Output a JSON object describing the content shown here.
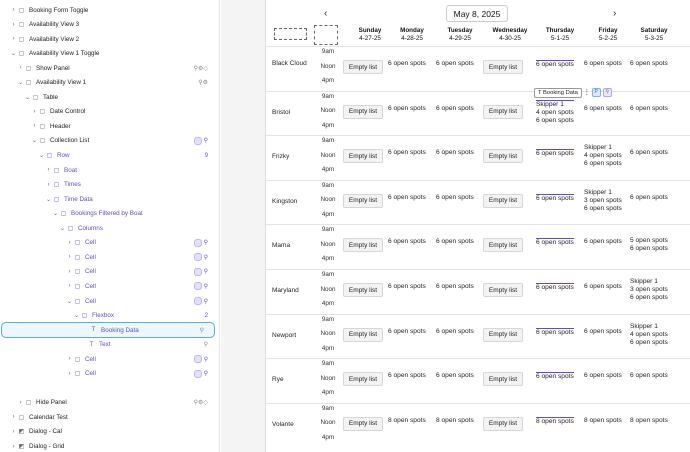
{
  "sidebar": {
    "items": [
      {
        "label": "Booking Form Toggle",
        "indent": 0,
        "chev": "›",
        "ico": "▢",
        "right": ""
      },
      {
        "label": "Availability View 3",
        "indent": 0,
        "chev": "›",
        "ico": "▢",
        "right": ""
      },
      {
        "label": "Availability View 2",
        "indent": 0,
        "chev": "›",
        "ico": "▢",
        "right": ""
      },
      {
        "label": "Availability View 1 Toggle",
        "indent": 0,
        "chev": "⌄",
        "ico": "▢",
        "right": ""
      },
      {
        "label": "Show Panel",
        "indent": 1,
        "chev": "›",
        "ico": "▢",
        "right": "⚲⚙◇"
      },
      {
        "label": "Availability View 1",
        "indent": 1,
        "chev": "⌄",
        "ico": "▢",
        "right": "⚲⚙"
      },
      {
        "label": "Table",
        "indent": 2,
        "chev": "⌄",
        "ico": "▢",
        "right": ""
      },
      {
        "label": "Date Control",
        "indent": 3,
        "chev": "›",
        "ico": "▢",
        "right": ""
      },
      {
        "label": "Header",
        "indent": 3,
        "chev": "›",
        "ico": "▢",
        "right": ""
      },
      {
        "label": "Collection List",
        "indent": 3,
        "chev": "⌄",
        "ico": "▢",
        "right": "pill-link"
      },
      {
        "label": "Row",
        "indent": 4,
        "chev": "⌄",
        "ico": "▢",
        "right": "9",
        "purple": true
      },
      {
        "label": "Boat",
        "indent": 5,
        "chev": "›",
        "ico": "▢",
        "purple": true,
        "right": ""
      },
      {
        "label": "Times",
        "indent": 5,
        "chev": "›",
        "ico": "▢",
        "purple": true,
        "right": ""
      },
      {
        "label": "Time Data",
        "indent": 5,
        "chev": "⌄",
        "ico": "▢",
        "purple": true,
        "right": ""
      },
      {
        "label": "Bookings Filtered by Boat",
        "indent": 6,
        "chev": "⌄",
        "ico": "▢",
        "purple": true,
        "right": ""
      },
      {
        "label": "Columns",
        "indent": 7,
        "chev": "⌄",
        "ico": "▢",
        "purple": true,
        "right": ""
      },
      {
        "label": "Cell",
        "indent": 8,
        "chev": "›",
        "ico": "▢",
        "purple": true,
        "right": "pill-link"
      },
      {
        "label": "Cell",
        "indent": 8,
        "chev": "›",
        "ico": "▢",
        "purple": true,
        "right": "pill-link"
      },
      {
        "label": "Cell",
        "indent": 8,
        "chev": "›",
        "ico": "▢",
        "purple": true,
        "right": "pill-link"
      },
      {
        "label": "Cell",
        "indent": 8,
        "chev": "›",
        "ico": "▢",
        "purple": true,
        "right": "pill-link"
      },
      {
        "label": "Cell",
        "indent": 8,
        "chev": "⌄",
        "ico": "▢",
        "purple": true,
        "right": "pill-link"
      },
      {
        "label": "Flexbox",
        "indent": 9,
        "chev": "⌄",
        "ico": "▢",
        "purple": true,
        "right": "2"
      },
      {
        "label": "Booking Data",
        "indent": 10,
        "chev": "",
        "ico": "T",
        "purple": true,
        "right": "⚲",
        "selected": true
      },
      {
        "label": "Text",
        "indent": 10,
        "chev": "",
        "ico": "T",
        "purple": true,
        "right": "⚲"
      },
      {
        "label": "Cell",
        "indent": 8,
        "chev": "›",
        "ico": "▢",
        "purple": true,
        "right": "pill-link"
      },
      {
        "label": "Cell",
        "indent": 8,
        "chev": "›",
        "ico": "▢",
        "purple": true,
        "right": "pill-link"
      },
      {
        "label": "",
        "indent": 0,
        "chev": "",
        "ico": "",
        "right": ""
      },
      {
        "label": "Hide Panel",
        "indent": 1,
        "chev": "›",
        "ico": "▢",
        "right": "⚲⚙◇"
      },
      {
        "label": "Calendar Test",
        "indent": 0,
        "chev": "›",
        "ico": "▢",
        "right": ""
      },
      {
        "label": "Dialog - Cal",
        "indent": 0,
        "chev": "›",
        "ico": "◩",
        "right": ""
      },
      {
        "label": "Dialog - Grid",
        "indent": 0,
        "chev": "›",
        "ico": "◩",
        "right": ""
      }
    ]
  },
  "calendar": {
    "date": "May 8, 2025",
    "prev": "‹",
    "next": "›",
    "days": [
      {
        "name": "Sunday",
        "date": "4-27-25"
      },
      {
        "name": "Monday",
        "date": "4-28-25"
      },
      {
        "name": "Tuesday",
        "date": "4-29-25"
      },
      {
        "name": "Wednesday",
        "date": "4-30-25"
      },
      {
        "name": "Thursday",
        "date": "5-1-25"
      },
      {
        "name": "Friday",
        "date": "5-2-25"
      },
      {
        "name": "Saturday",
        "date": "5-3-25"
      }
    ],
    "times": [
      "9am",
      "Noon",
      "4pm"
    ],
    "empty_label": "Empty list",
    "tag_label": "Booking Data",
    "boats": [
      {
        "name": "Black Cloud",
        "cells": [
          [
            "Empty list"
          ],
          [
            "6 open spots"
          ],
          [
            "6 open spots"
          ],
          [
            "Empty list"
          ],
          [
            "6 open spots"
          ],
          [
            "6 open spots"
          ],
          [
            "6 open spots"
          ]
        ]
      },
      {
        "name": "Bristol",
        "cells": [
          [
            "Empty list"
          ],
          [
            "6 open spots"
          ],
          [
            "6 open spots"
          ],
          [
            "Empty list"
          ],
          [
            "Skipper 1",
            "4 open spots",
            "6 open spots"
          ],
          [
            "6 open spots"
          ],
          [
            "6 open spots"
          ]
        ]
      },
      {
        "name": "Frizky",
        "cells": [
          [
            "Empty list"
          ],
          [
            "6 open spots"
          ],
          [
            "6 open spots"
          ],
          [
            "Empty list"
          ],
          [
            "6 open spots"
          ],
          [
            "Skipper 1",
            "4 open spots",
            "6 open spots"
          ],
          [
            "6 open spots"
          ]
        ]
      },
      {
        "name": "Kingston",
        "cells": [
          [
            "Empty list"
          ],
          [
            "6 open spots"
          ],
          [
            "6 open spots"
          ],
          [
            "Empty list"
          ],
          [
            "6 open spots"
          ],
          [
            "Skipper 1",
            "3 open spots",
            "6 open spots"
          ],
          [
            "6 open spots"
          ]
        ]
      },
      {
        "name": "Mama",
        "cells": [
          [
            "Empty list"
          ],
          [
            "6 open spots"
          ],
          [
            "6 open spots"
          ],
          [
            "Empty list"
          ],
          [
            "6 open spots"
          ],
          [
            "6 open spots"
          ],
          [
            "5 open spots",
            "6 open spots"
          ]
        ]
      },
      {
        "name": "Maryland",
        "cells": [
          [
            "Empty list"
          ],
          [
            "6 open spots"
          ],
          [
            "6 open spots"
          ],
          [
            "Empty list"
          ],
          [
            "6 open spots"
          ],
          [
            "6 open spots"
          ],
          [
            "Skipper 1",
            "3 open spots",
            "6 open spots"
          ]
        ]
      },
      {
        "name": "Newport",
        "cells": [
          [
            "Empty list"
          ],
          [
            "6 open spots"
          ],
          [
            "6 open spots"
          ],
          [
            "Empty list"
          ],
          [
            "6 open spots"
          ],
          [
            "6 open spots"
          ],
          [
            "Skipper 1",
            "4 open spots",
            "6 open spots"
          ]
        ]
      },
      {
        "name": "Rye",
        "cells": [
          [
            "Empty list"
          ],
          [
            "6 open spots"
          ],
          [
            "6 open spots"
          ],
          [
            "Empty list"
          ],
          [
            "6 open spots"
          ],
          [
            "6 open spots"
          ],
          [
            "6 open spots"
          ]
        ]
      },
      {
        "name": "Volante",
        "cells": [
          [
            "Empty list"
          ],
          [
            "8 open spots"
          ],
          [
            "8 open spots"
          ],
          [
            "Empty list"
          ],
          [
            "8 open spots"
          ],
          [
            "8 open spots"
          ],
          [
            "8 open spots"
          ]
        ]
      }
    ]
  },
  "colors": {
    "accent": "#5b4fc7",
    "selection": "#5aa7e6"
  }
}
